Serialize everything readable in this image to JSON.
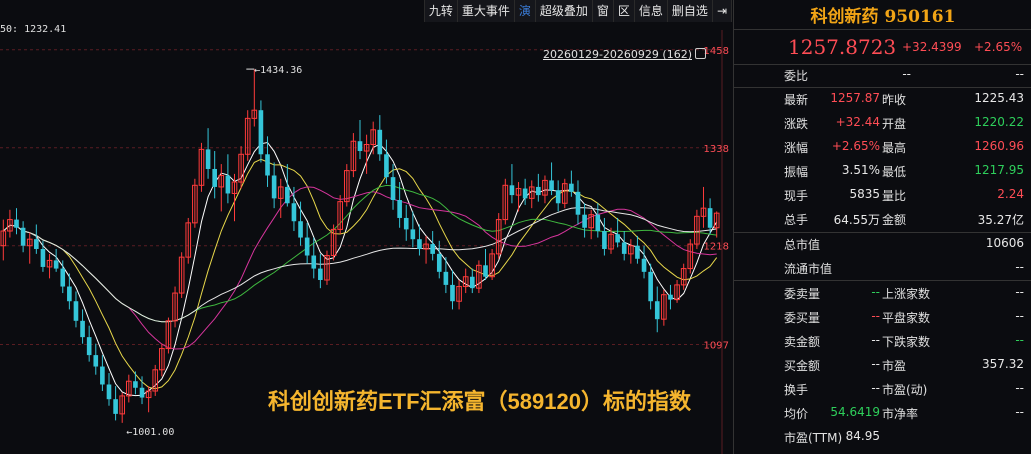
{
  "toolbar": {
    "items": [
      "九转",
      "重大事件",
      "演",
      "超级叠加",
      "窗",
      "区",
      "信息",
      "删自选",
      "⇥"
    ]
  },
  "chart": {
    "ma_readout": "50: 1232.41",
    "range_label": "20260129-20260929 (162)",
    "overlay_caption": "科创创新药ETF汇添富（589120）标的指数",
    "high_marker": "1434.36",
    "low_marker": "1001.00",
    "y_ticks": [
      "1458",
      "1338",
      "1218",
      "1097"
    ]
  },
  "chart_data": {
    "type": "candlestick",
    "y_range": [
      980,
      1470
    ],
    "annotations": {
      "max": 1434.36,
      "min": 1001.0
    },
    "candles": [
      [
        1218,
        1250,
        1200,
        1236
      ],
      [
        1236,
        1262,
        1228,
        1250
      ],
      [
        1250,
        1264,
        1232,
        1240
      ],
      [
        1240,
        1248,
        1210,
        1218
      ],
      [
        1218,
        1234,
        1196,
        1226
      ],
      [
        1226,
        1244,
        1208,
        1214
      ],
      [
        1214,
        1224,
        1186,
        1192
      ],
      [
        1192,
        1208,
        1178,
        1200
      ],
      [
        1200,
        1214,
        1186,
        1190
      ],
      [
        1190,
        1200,
        1160,
        1168
      ],
      [
        1168,
        1184,
        1140,
        1150
      ],
      [
        1150,
        1162,
        1118,
        1126
      ],
      [
        1126,
        1140,
        1098,
        1106
      ],
      [
        1106,
        1120,
        1076,
        1084
      ],
      [
        1084,
        1098,
        1060,
        1070
      ],
      [
        1070,
        1084,
        1040,
        1048
      ],
      [
        1048,
        1062,
        1022,
        1030
      ],
      [
        1030,
        1046,
        1004,
        1012
      ],
      [
        1012,
        1038,
        1001,
        1034
      ],
      [
        1034,
        1060,
        1026,
        1052
      ],
      [
        1052,
        1064,
        1036,
        1044
      ],
      [
        1044,
        1058,
        1024,
        1032
      ],
      [
        1032,
        1046,
        1014,
        1040
      ],
      [
        1040,
        1072,
        1034,
        1066
      ],
      [
        1066,
        1098,
        1058,
        1092
      ],
      [
        1092,
        1130,
        1086,
        1126
      ],
      [
        1126,
        1168,
        1118,
        1160
      ],
      [
        1160,
        1210,
        1154,
        1204
      ],
      [
        1204,
        1252,
        1196,
        1246
      ],
      [
        1246,
        1300,
        1240,
        1292
      ],
      [
        1292,
        1344,
        1284,
        1336
      ],
      [
        1336,
        1362,
        1300,
        1312
      ],
      [
        1312,
        1334,
        1276,
        1290
      ],
      [
        1290,
        1318,
        1260,
        1304
      ],
      [
        1304,
        1330,
        1270,
        1282
      ],
      [
        1282,
        1306,
        1248,
        1296
      ],
      [
        1296,
        1340,
        1288,
        1330
      ],
      [
        1330,
        1384,
        1322,
        1374
      ],
      [
        1374,
        1434,
        1364,
        1384
      ],
      [
        1384,
        1396,
        1320,
        1330
      ],
      [
        1330,
        1352,
        1290,
        1304
      ],
      [
        1304,
        1320,
        1264,
        1276
      ],
      [
        1276,
        1300,
        1252,
        1290
      ],
      [
        1290,
        1318,
        1266,
        1270
      ],
      [
        1270,
        1290,
        1236,
        1248
      ],
      [
        1248,
        1272,
        1218,
        1228
      ],
      [
        1228,
        1246,
        1196,
        1206
      ],
      [
        1206,
        1228,
        1178,
        1190
      ],
      [
        1190,
        1208,
        1166,
        1176
      ],
      [
        1176,
        1212,
        1170,
        1206
      ],
      [
        1206,
        1244,
        1200,
        1238
      ],
      [
        1238,
        1280,
        1232,
        1272
      ],
      [
        1272,
        1318,
        1266,
        1310
      ],
      [
        1310,
        1356,
        1302,
        1346
      ],
      [
        1346,
        1372,
        1324,
        1334
      ],
      [
        1334,
        1354,
        1306,
        1342
      ],
      [
        1342,
        1370,
        1330,
        1360
      ],
      [
        1360,
        1378,
        1322,
        1330
      ],
      [
        1330,
        1348,
        1294,
        1302
      ],
      [
        1302,
        1318,
        1262,
        1274
      ],
      [
        1274,
        1296,
        1240,
        1252
      ],
      [
        1252,
        1268,
        1224,
        1238
      ],
      [
        1238,
        1260,
        1216,
        1226
      ],
      [
        1226,
        1244,
        1206,
        1214
      ],
      [
        1214,
        1230,
        1196,
        1220
      ],
      [
        1220,
        1236,
        1200,
        1208
      ],
      [
        1208,
        1224,
        1178,
        1186
      ],
      [
        1186,
        1204,
        1160,
        1170
      ],
      [
        1170,
        1188,
        1140,
        1150
      ],
      [
        1150,
        1176,
        1140,
        1168
      ],
      [
        1168,
        1190,
        1160,
        1180
      ],
      [
        1180,
        1190,
        1160,
        1166
      ],
      [
        1166,
        1200,
        1160,
        1194
      ],
      [
        1194,
        1214,
        1176,
        1180
      ],
      [
        1180,
        1214,
        1176,
        1208
      ],
      [
        1208,
        1258,
        1202,
        1250
      ],
      [
        1250,
        1300,
        1244,
        1292
      ],
      [
        1292,
        1318,
        1270,
        1280
      ],
      [
        1280,
        1296,
        1260,
        1288
      ],
      [
        1288,
        1300,
        1268,
        1276
      ],
      [
        1276,
        1298,
        1264,
        1290
      ],
      [
        1290,
        1306,
        1272,
        1280
      ],
      [
        1280,
        1304,
        1270,
        1298
      ],
      [
        1298,
        1320,
        1280,
        1286
      ],
      [
        1286,
        1298,
        1260,
        1270
      ],
      [
        1270,
        1300,
        1264,
        1294
      ],
      [
        1294,
        1310,
        1278,
        1284
      ],
      [
        1284,
        1298,
        1244,
        1256
      ],
      [
        1256,
        1270,
        1228,
        1240
      ],
      [
        1240,
        1262,
        1226,
        1256
      ],
      [
        1256,
        1270,
        1228,
        1236
      ],
      [
        1236,
        1252,
        1206,
        1214
      ],
      [
        1214,
        1240,
        1208,
        1232
      ],
      [
        1232,
        1252,
        1216,
        1222
      ],
      [
        1222,
        1236,
        1200,
        1208
      ],
      [
        1208,
        1226,
        1196,
        1218
      ],
      [
        1218,
        1230,
        1196,
        1202
      ],
      [
        1202,
        1218,
        1178,
        1186
      ],
      [
        1186,
        1196,
        1140,
        1150
      ],
      [
        1150,
        1168,
        1112,
        1128
      ],
      [
        1128,
        1164,
        1120,
        1158
      ],
      [
        1158,
        1170,
        1140,
        1152
      ],
      [
        1152,
        1176,
        1148,
        1170
      ],
      [
        1170,
        1196,
        1164,
        1190
      ],
      [
        1190,
        1226,
        1184,
        1220
      ],
      [
        1220,
        1262,
        1214,
        1254
      ],
      [
        1254,
        1290,
        1240,
        1264
      ],
      [
        1264,
        1276,
        1232,
        1240
      ],
      [
        1240,
        1260,
        1228,
        1257.87
      ]
    ]
  },
  "panel": {
    "title": "科创新药 950161",
    "price": "1257.8723",
    "change": "+32.4399",
    "change_pct": "+2.65%",
    "weibi": {
      "label": "委比",
      "v1": "--",
      "v2": "--"
    },
    "grid": [
      {
        "l1": "最新",
        "v1": "1257.87",
        "c1": "red",
        "l2": "昨收",
        "v2": "1225.43",
        "c2": "white"
      },
      {
        "l1": "涨跌",
        "v1": "+32.44",
        "c1": "red",
        "l2": "开盘",
        "v2": "1220.22",
        "c2": "green"
      },
      {
        "l1": "涨幅",
        "v1": "+2.65%",
        "c1": "red",
        "l2": "最高",
        "v2": "1260.96",
        "c2": "red"
      },
      {
        "l1": "振幅",
        "v1": "3.51%",
        "c1": "white",
        "l2": "最低",
        "v2": "1217.95",
        "c2": "green"
      },
      {
        "l1": "现手",
        "v1": "5835",
        "c1": "white",
        "l2": "量比",
        "v2": "2.24",
        "c2": "red"
      },
      {
        "l1": "总手",
        "v1": "64.55万",
        "c1": "white",
        "l2": "金额",
        "v2": "35.27亿",
        "c2": "white"
      }
    ],
    "mkt": [
      {
        "l": "总市值",
        "v": "10606"
      },
      {
        "l": "流通市值",
        "v": "--"
      }
    ],
    "bottom": [
      {
        "l1": "委卖量",
        "v1": "--",
        "c1": "green",
        "l2": "上涨家数",
        "v2": "--",
        "c2": "white"
      },
      {
        "l1": "委买量",
        "v1": "--",
        "c1": "red",
        "l2": "平盘家数",
        "v2": "--",
        "c2": "white"
      },
      {
        "l1": "卖金额",
        "v1": "--",
        "c1": "white",
        "l2": "下跌家数",
        "v2": "--",
        "c2": "green"
      },
      {
        "l1": "买金额",
        "v1": "--",
        "c1": "white",
        "l2": "市盈",
        "v2": "357.32",
        "c2": "white"
      },
      {
        "l1": "换手",
        "v1": "--",
        "c1": "white",
        "l2": "市盈(动)",
        "v2": "--",
        "c2": "white"
      },
      {
        "l1": "均价",
        "v1": "54.6419",
        "c1": "green",
        "l2": "市净率",
        "v2": "--",
        "c2": "white"
      },
      {
        "l1": "市盈(TTM)",
        "v1": "84.95",
        "c1": "white",
        "l2": "",
        "v2": "",
        "c2": "white"
      }
    ]
  }
}
